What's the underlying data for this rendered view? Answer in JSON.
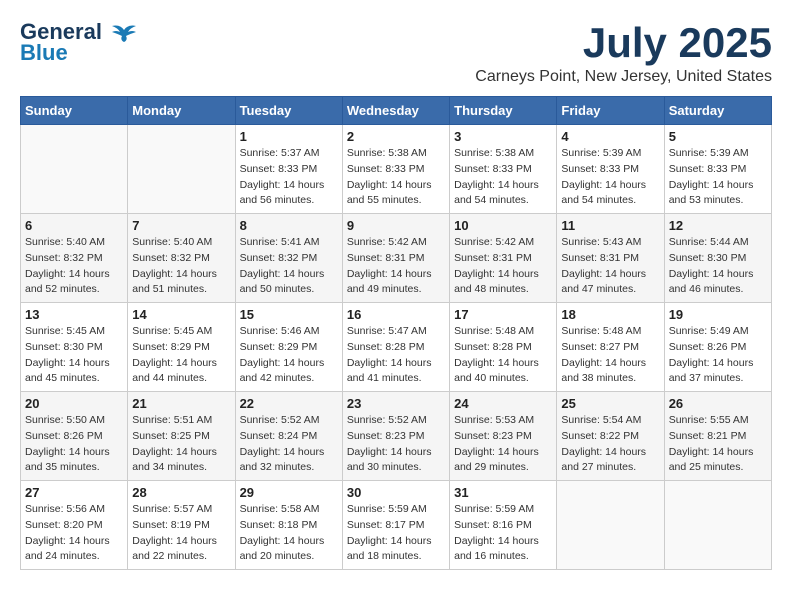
{
  "header": {
    "logo_line1": "General",
    "logo_line2": "Blue",
    "month": "July 2025",
    "location": "Carneys Point, New Jersey, United States"
  },
  "weekdays": [
    "Sunday",
    "Monday",
    "Tuesday",
    "Wednesday",
    "Thursday",
    "Friday",
    "Saturday"
  ],
  "weeks": [
    [
      {
        "day": "",
        "info": ""
      },
      {
        "day": "",
        "info": ""
      },
      {
        "day": "1",
        "info": "Sunrise: 5:37 AM\nSunset: 8:33 PM\nDaylight: 14 hours\nand 56 minutes."
      },
      {
        "day": "2",
        "info": "Sunrise: 5:38 AM\nSunset: 8:33 PM\nDaylight: 14 hours\nand 55 minutes."
      },
      {
        "day": "3",
        "info": "Sunrise: 5:38 AM\nSunset: 8:33 PM\nDaylight: 14 hours\nand 54 minutes."
      },
      {
        "day": "4",
        "info": "Sunrise: 5:39 AM\nSunset: 8:33 PM\nDaylight: 14 hours\nand 54 minutes."
      },
      {
        "day": "5",
        "info": "Sunrise: 5:39 AM\nSunset: 8:33 PM\nDaylight: 14 hours\nand 53 minutes."
      }
    ],
    [
      {
        "day": "6",
        "info": "Sunrise: 5:40 AM\nSunset: 8:32 PM\nDaylight: 14 hours\nand 52 minutes."
      },
      {
        "day": "7",
        "info": "Sunrise: 5:40 AM\nSunset: 8:32 PM\nDaylight: 14 hours\nand 51 minutes."
      },
      {
        "day": "8",
        "info": "Sunrise: 5:41 AM\nSunset: 8:32 PM\nDaylight: 14 hours\nand 50 minutes."
      },
      {
        "day": "9",
        "info": "Sunrise: 5:42 AM\nSunset: 8:31 PM\nDaylight: 14 hours\nand 49 minutes."
      },
      {
        "day": "10",
        "info": "Sunrise: 5:42 AM\nSunset: 8:31 PM\nDaylight: 14 hours\nand 48 minutes."
      },
      {
        "day": "11",
        "info": "Sunrise: 5:43 AM\nSunset: 8:31 PM\nDaylight: 14 hours\nand 47 minutes."
      },
      {
        "day": "12",
        "info": "Sunrise: 5:44 AM\nSunset: 8:30 PM\nDaylight: 14 hours\nand 46 minutes."
      }
    ],
    [
      {
        "day": "13",
        "info": "Sunrise: 5:45 AM\nSunset: 8:30 PM\nDaylight: 14 hours\nand 45 minutes."
      },
      {
        "day": "14",
        "info": "Sunrise: 5:45 AM\nSunset: 8:29 PM\nDaylight: 14 hours\nand 44 minutes."
      },
      {
        "day": "15",
        "info": "Sunrise: 5:46 AM\nSunset: 8:29 PM\nDaylight: 14 hours\nand 42 minutes."
      },
      {
        "day": "16",
        "info": "Sunrise: 5:47 AM\nSunset: 8:28 PM\nDaylight: 14 hours\nand 41 minutes."
      },
      {
        "day": "17",
        "info": "Sunrise: 5:48 AM\nSunset: 8:28 PM\nDaylight: 14 hours\nand 40 minutes."
      },
      {
        "day": "18",
        "info": "Sunrise: 5:48 AM\nSunset: 8:27 PM\nDaylight: 14 hours\nand 38 minutes."
      },
      {
        "day": "19",
        "info": "Sunrise: 5:49 AM\nSunset: 8:26 PM\nDaylight: 14 hours\nand 37 minutes."
      }
    ],
    [
      {
        "day": "20",
        "info": "Sunrise: 5:50 AM\nSunset: 8:26 PM\nDaylight: 14 hours\nand 35 minutes."
      },
      {
        "day": "21",
        "info": "Sunrise: 5:51 AM\nSunset: 8:25 PM\nDaylight: 14 hours\nand 34 minutes."
      },
      {
        "day": "22",
        "info": "Sunrise: 5:52 AM\nSunset: 8:24 PM\nDaylight: 14 hours\nand 32 minutes."
      },
      {
        "day": "23",
        "info": "Sunrise: 5:52 AM\nSunset: 8:23 PM\nDaylight: 14 hours\nand 30 minutes."
      },
      {
        "day": "24",
        "info": "Sunrise: 5:53 AM\nSunset: 8:23 PM\nDaylight: 14 hours\nand 29 minutes."
      },
      {
        "day": "25",
        "info": "Sunrise: 5:54 AM\nSunset: 8:22 PM\nDaylight: 14 hours\nand 27 minutes."
      },
      {
        "day": "26",
        "info": "Sunrise: 5:55 AM\nSunset: 8:21 PM\nDaylight: 14 hours\nand 25 minutes."
      }
    ],
    [
      {
        "day": "27",
        "info": "Sunrise: 5:56 AM\nSunset: 8:20 PM\nDaylight: 14 hours\nand 24 minutes."
      },
      {
        "day": "28",
        "info": "Sunrise: 5:57 AM\nSunset: 8:19 PM\nDaylight: 14 hours\nand 22 minutes."
      },
      {
        "day": "29",
        "info": "Sunrise: 5:58 AM\nSunset: 8:18 PM\nDaylight: 14 hours\nand 20 minutes."
      },
      {
        "day": "30",
        "info": "Sunrise: 5:59 AM\nSunset: 8:17 PM\nDaylight: 14 hours\nand 18 minutes."
      },
      {
        "day": "31",
        "info": "Sunrise: 5:59 AM\nSunset: 8:16 PM\nDaylight: 14 hours\nand 16 minutes."
      },
      {
        "day": "",
        "info": ""
      },
      {
        "day": "",
        "info": ""
      }
    ]
  ]
}
